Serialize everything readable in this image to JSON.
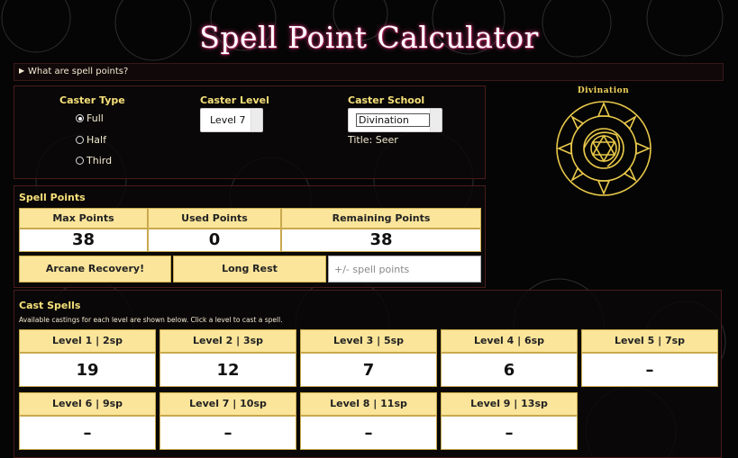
{
  "page": {
    "title": "Spell Point Calculator"
  },
  "details": {
    "summary": "What are spell points?"
  },
  "caster_type": {
    "label": "Caster Type",
    "options": [
      {
        "label": "Full",
        "checked": true
      },
      {
        "label": "Half",
        "checked": false
      },
      {
        "label": "Third",
        "checked": false
      }
    ]
  },
  "caster_level": {
    "label": "Caster Level",
    "value": "Level 7"
  },
  "caster_school": {
    "label": "Caster School",
    "value": "Divination",
    "title_text": "Title: Seer"
  },
  "school_emblem": {
    "caption": "Divination",
    "icon": "divination-sigil-icon"
  },
  "spell_points": {
    "label": "Spell Points",
    "max_label": "Max Points",
    "max_value": "38",
    "used_label": "Used Points",
    "used_value": "0",
    "remaining_label": "Remaining Points",
    "remaining_value": "38",
    "arcane_recovery_label": "Arcane Recovery!",
    "long_rest_label": "Long Rest",
    "adjust_placeholder": "+/- spell points"
  },
  "cast_spells": {
    "label": "Cast Spells",
    "hint": "Available castings for each level are shown below. Click a level to cast a spell.",
    "levels": [
      {
        "label": "Level 1 | 2sp",
        "count": "19"
      },
      {
        "label": "Level 2 | 3sp",
        "count": "12"
      },
      {
        "label": "Level 3 | 5sp",
        "count": "7"
      },
      {
        "label": "Level 4 | 6sp",
        "count": "6"
      },
      {
        "label": "Level 5 | 7sp",
        "count": "–"
      },
      {
        "label": "Level 6 | 9sp",
        "count": "–"
      },
      {
        "label": "Level 7 | 10sp",
        "count": "–"
      },
      {
        "label": "Level 8 | 11sp",
        "count": "–"
      },
      {
        "label": "Level 9 | 13sp",
        "count": "–"
      }
    ]
  },
  "colors": {
    "accent": "#f6e07a",
    "button_bg": "#fbe59a",
    "title_glow": "#c2306b",
    "panel_border": "#4a1b1b"
  }
}
